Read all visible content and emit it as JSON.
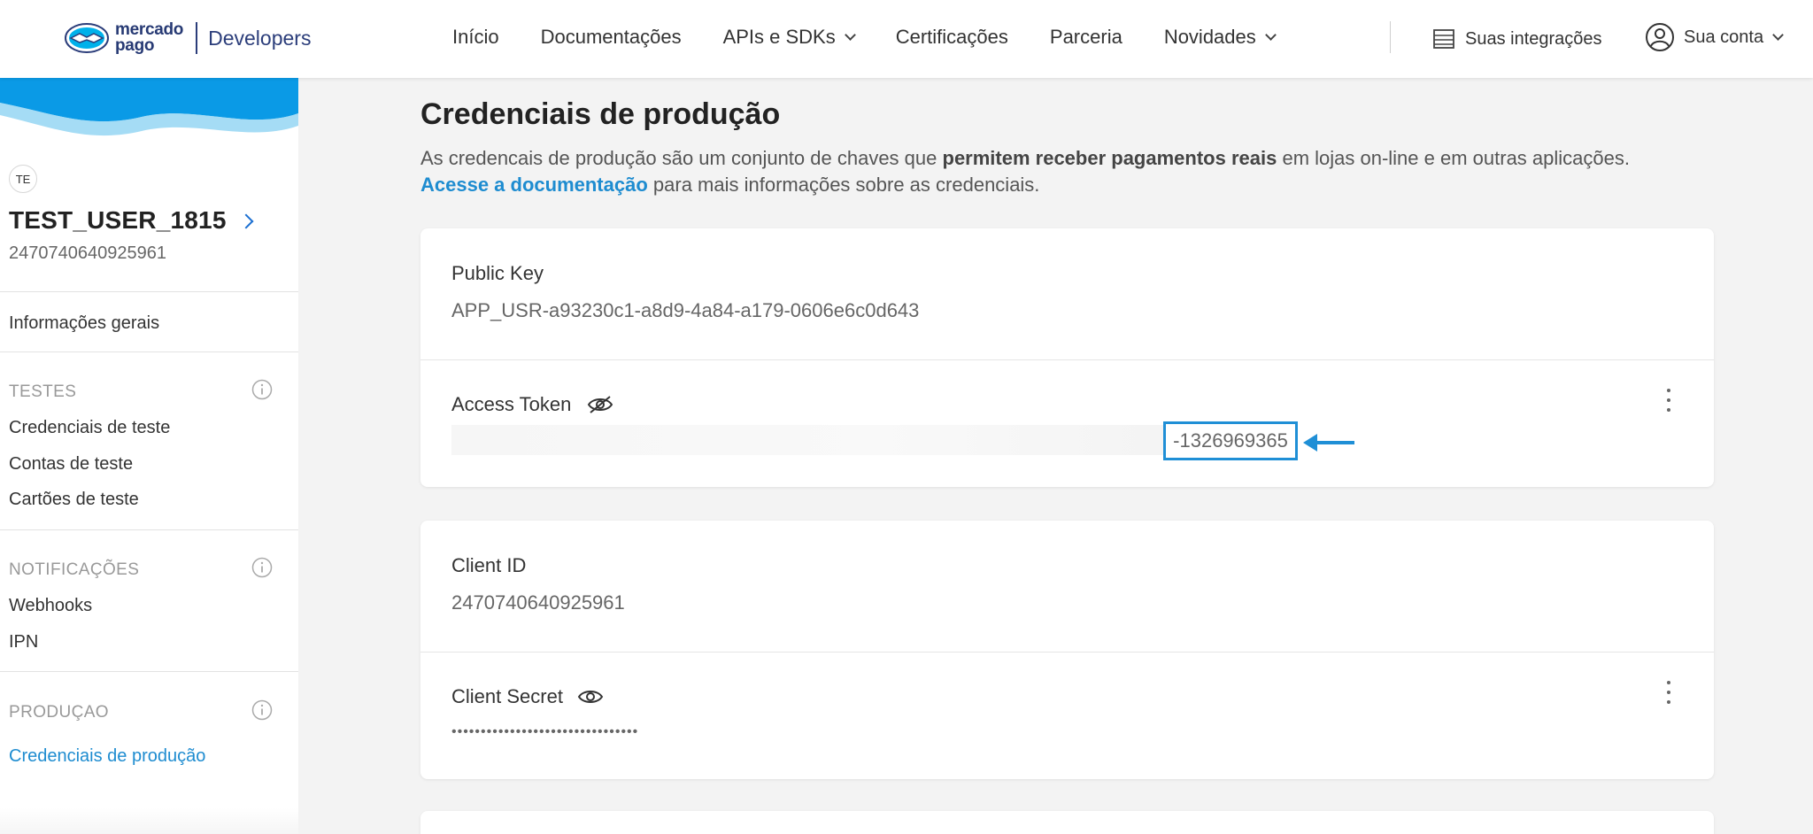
{
  "header": {
    "brand_line1": "mercado",
    "brand_line2": "pago",
    "brand_product": "Developers",
    "nav": [
      {
        "label": "Início",
        "dropdown": false
      },
      {
        "label": "Documentações",
        "dropdown": false
      },
      {
        "label": "APIs e SDKs",
        "dropdown": true
      },
      {
        "label": "Certificações",
        "dropdown": false
      },
      {
        "label": "Parceria",
        "dropdown": false
      },
      {
        "label": "Novidades",
        "dropdown": true
      }
    ],
    "integrations_label": "Suas integrações",
    "account_label": "Sua conta"
  },
  "sidebar": {
    "avatar_initials": "TE",
    "user_name": "TEST_USER_1815",
    "user_id": "2470740640925961",
    "general_info": "Informações gerais",
    "sections": [
      {
        "title": "TESTES",
        "items": [
          "Credenciais de teste",
          "Contas de teste",
          "Cartões de teste"
        ]
      },
      {
        "title": "NOTIFICAÇÕES",
        "items": [
          "Webhooks",
          "IPN"
        ]
      },
      {
        "title": "PRODUÇAO",
        "items": [
          "Credenciais de produção"
        ]
      }
    ]
  },
  "main": {
    "title": "Credenciais de produção",
    "desc_part1": "As credencais de produção são um conjunto de chaves que ",
    "desc_bold": "permitem receber pagamentos reais",
    "desc_part2": " em lojas on-line e em outras aplicações.",
    "doc_link": "Acesse a documentação",
    "desc_part3": " para mais informações sobre as credenciais.",
    "public_key_label": "Public Key",
    "public_key_value": "APP_USR-a93230c1-a8d9-4a84-a179-0606e6c0d643",
    "access_token_label": "Access Token",
    "access_token_visible_suffix": "-1326969365",
    "client_id_label": "Client ID",
    "client_id_value": "2470740640925961",
    "client_secret_label": "Client Secret",
    "client_secret_value": "••••••••••••••••••••••••••••••••"
  },
  "colors": {
    "accent": "#1e8cd0",
    "brand": "#273a74"
  }
}
